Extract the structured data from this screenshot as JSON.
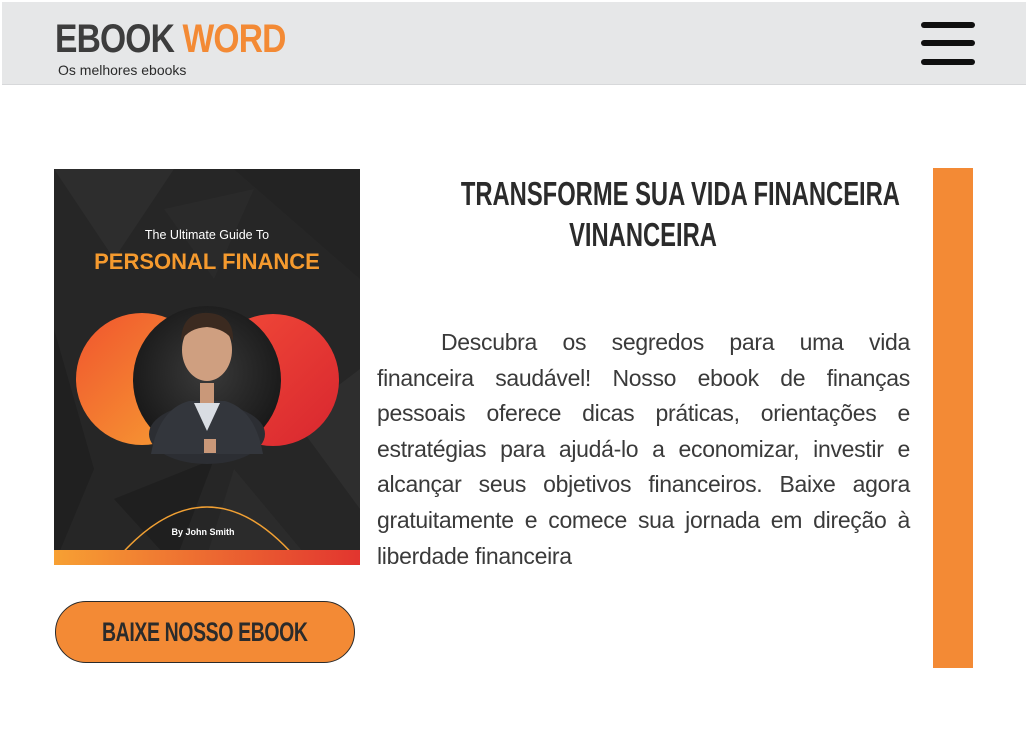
{
  "header": {
    "logo_word1": "EBOOK",
    "logo_word2": "WORD",
    "tagline": "Os melhores ebooks",
    "menu_icon": "hamburger-menu-icon"
  },
  "cover": {
    "subtitle": "The Ultimate Guide To",
    "title": "PERSONAL FINANCE",
    "author": "By John Smith"
  },
  "main": {
    "headline_line1": "TRANSFORME SUA VIDA FINANCEIRA",
    "headline_line2": "VINANCEIRA",
    "description": "Descubra os segredos para uma vida financeira saudável! Nosso ebook de finanças pessoais oferece dicas práticas, orientações e estratégias para ajudá-lo a economizar, investir e alcançar seus objetivos financeiros. Baixe agora gratuitamente e comece sua jornada em direção à liberdade financeira",
    "download_label": "BAIXE NOSSO EBOOK"
  },
  "colors": {
    "accent": "#f38a35",
    "header_bg": "#e6e7e8",
    "text_dark": "#2b2b2b"
  }
}
